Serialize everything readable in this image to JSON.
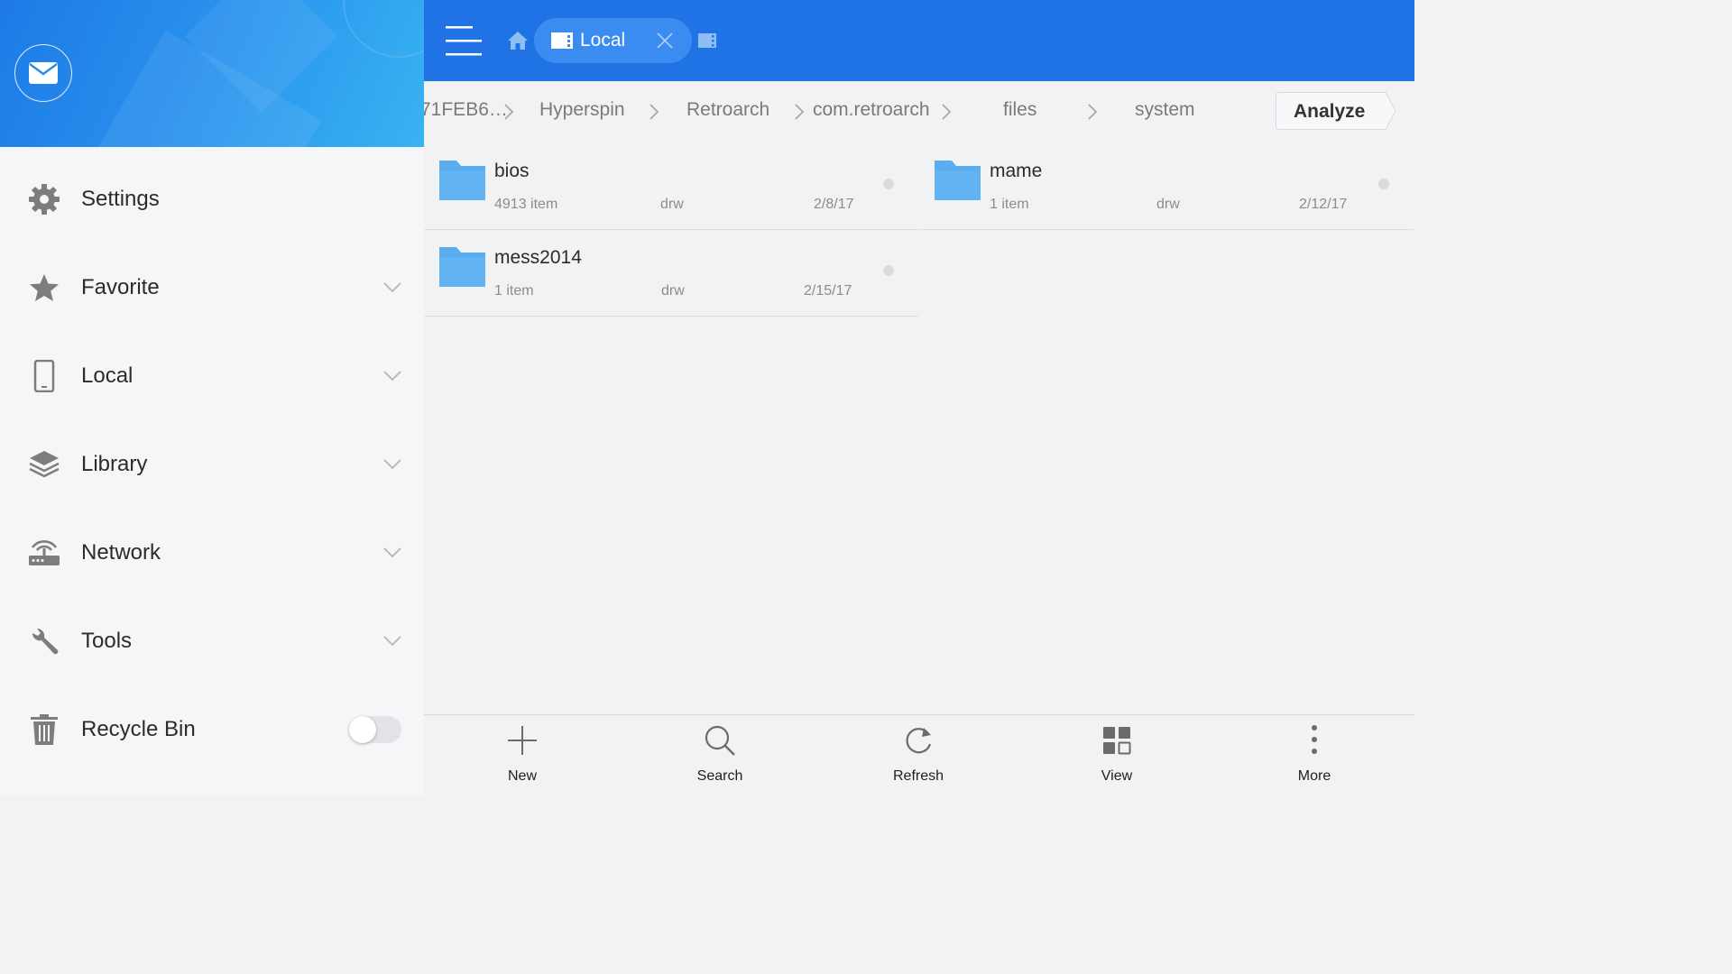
{
  "drawer": {
    "items": [
      {
        "label": "Settings",
        "icon": "gear-icon"
      },
      {
        "label": "Favorite",
        "icon": "star-icon"
      },
      {
        "label": "Local",
        "icon": "phone-icon"
      },
      {
        "label": "Library",
        "icon": "layers-icon"
      },
      {
        "label": "Network",
        "icon": "router-icon"
      },
      {
        "label": "Tools",
        "icon": "wrench-icon"
      },
      {
        "label": "Recycle Bin",
        "icon": "trash-icon"
      }
    ],
    "recycle_bin_enabled": false
  },
  "topbar": {
    "active_tab": "Local"
  },
  "breadcrumb": {
    "items": [
      "71FEB6…",
      "Hyperspin",
      "Retroarch",
      "com.retroarch",
      "files",
      "system"
    ],
    "analyze_label": "Analyze"
  },
  "files": [
    {
      "name": "bios",
      "count": "4913 item",
      "perm": "drw",
      "date": "2/8/17"
    },
    {
      "name": "mame",
      "count": "1 item",
      "perm": "drw",
      "date": "2/12/17"
    },
    {
      "name": "mess2014",
      "count": "1 item",
      "perm": "drw",
      "date": "2/15/17"
    }
  ],
  "toolbar": {
    "new_label": "New",
    "search_label": "Search",
    "refresh_label": "Refresh",
    "view_label": "View",
    "more_label": "More"
  },
  "colors": {
    "topbar": "#1f73e4",
    "tab": "#3a8cf0",
    "folder": "#5aaef0",
    "icon_gray": "#7d7d7d"
  }
}
